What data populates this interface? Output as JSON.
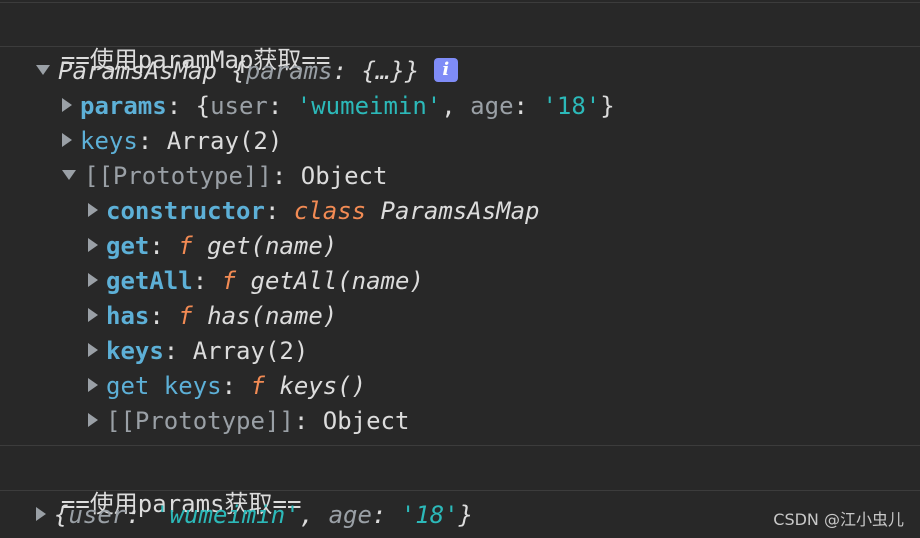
{
  "log1": {
    "text": "==使用paramMap获取=="
  },
  "obj": {
    "class_name": "ParamsAsMap",
    "preview_open": " {",
    "preview_key": "params",
    "preview_colon": ": ",
    "preview_val": "{…}",
    "preview_close": "}",
    "info_icon": "i"
  },
  "props": {
    "params": {
      "key": "params",
      "colon": ": ",
      "open": "{",
      "k1": "user",
      "c1": ": ",
      "v1": "'wumeimin'",
      "sep": ", ",
      "k2": "age",
      "c2": ": ",
      "v2": "'18'",
      "close": "}"
    },
    "keys": {
      "key": "keys",
      "colon": ": ",
      "value": "Array(2)"
    },
    "proto": {
      "key": "[[Prototype]]",
      "colon": ": ",
      "value": "Object"
    }
  },
  "proto_items": {
    "constructor": {
      "key": "constructor",
      "colon": ": ",
      "kw": "class",
      "name": " ParamsAsMap"
    },
    "get": {
      "key": "get",
      "colon": ": ",
      "kw": "f",
      "sig": " get(name)"
    },
    "getAll": {
      "key": "getAll",
      "colon": ": ",
      "kw": "f",
      "sig": " getAll(name)"
    },
    "has": {
      "key": "has",
      "colon": ": ",
      "kw": "f",
      "sig": " has(name)"
    },
    "keys": {
      "key": "keys",
      "colon": ": ",
      "value": "Array(2)"
    },
    "get_keys": {
      "key": "get keys",
      "colon": ": ",
      "kw": "f",
      "sig": " keys()"
    },
    "proto": {
      "key": "[[Prototype]]",
      "colon": ": ",
      "value": "Object"
    }
  },
  "log2": {
    "text": "==使用params获取=="
  },
  "obj2": {
    "open": "{",
    "k1": "user",
    "c1": ": ",
    "v1": "'wumeimin'",
    "sep": ", ",
    "k2": "age",
    "c2": ": ",
    "v2": "'18'",
    "close": "}"
  },
  "watermark": "CSDN @江小虫儿"
}
